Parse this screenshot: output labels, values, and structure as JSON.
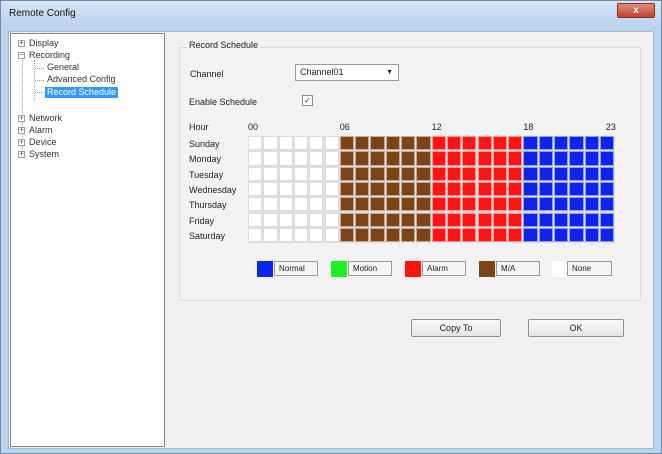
{
  "window": {
    "title": "Remote Config",
    "close_label": "x"
  },
  "tree": {
    "items": [
      {
        "label": "Display",
        "expander": "+"
      },
      {
        "label": "Recording",
        "expander": "-"
      },
      {
        "label": "General"
      },
      {
        "label": "Advanced Config"
      },
      {
        "label": "Record Schedule",
        "selected": true
      },
      {
        "label": "Network",
        "expander": "+"
      },
      {
        "label": "Alarm",
        "expander": "+"
      },
      {
        "label": "Device",
        "expander": "+"
      },
      {
        "label": "System",
        "expander": "+"
      }
    ]
  },
  "record_schedule": {
    "group_title": "Record Schedule",
    "channel_label": "Channel",
    "channel_value": "Channel01",
    "enable_label": "Enable Schedule",
    "enable_checked": "✓",
    "hour_label": "Hour",
    "hour_ticks": [
      "00",
      "06",
      "12",
      "18",
      "23"
    ],
    "days": [
      "Sunday",
      "Monday",
      "Tuesday",
      "Wednesday",
      "Thursday",
      "Friday",
      "Saturday"
    ],
    "hour_modes": [
      "none",
      "none",
      "none",
      "none",
      "none",
      "none",
      "ma",
      "ma",
      "ma",
      "ma",
      "ma",
      "ma",
      "alarm",
      "alarm",
      "alarm",
      "alarm",
      "alarm",
      "alarm",
      "normal",
      "normal",
      "normal",
      "normal",
      "normal",
      "normal"
    ],
    "legend": [
      {
        "mode": "normal",
        "label": "Normal"
      },
      {
        "mode": "motion",
        "label": "Motion"
      },
      {
        "mode": "alarm",
        "label": "Alarm"
      },
      {
        "mode": "ma",
        "label": "M/A"
      },
      {
        "mode": "none",
        "label": "None"
      }
    ],
    "colors": {
      "normal": "#0d24ee",
      "motion": "#1df21d",
      "alarm": "#ff1313",
      "ma": "#7c4417",
      "none": "#ffffff"
    }
  },
  "actions": {
    "copy_label": "Copy To",
    "ok_label": "OK"
  }
}
